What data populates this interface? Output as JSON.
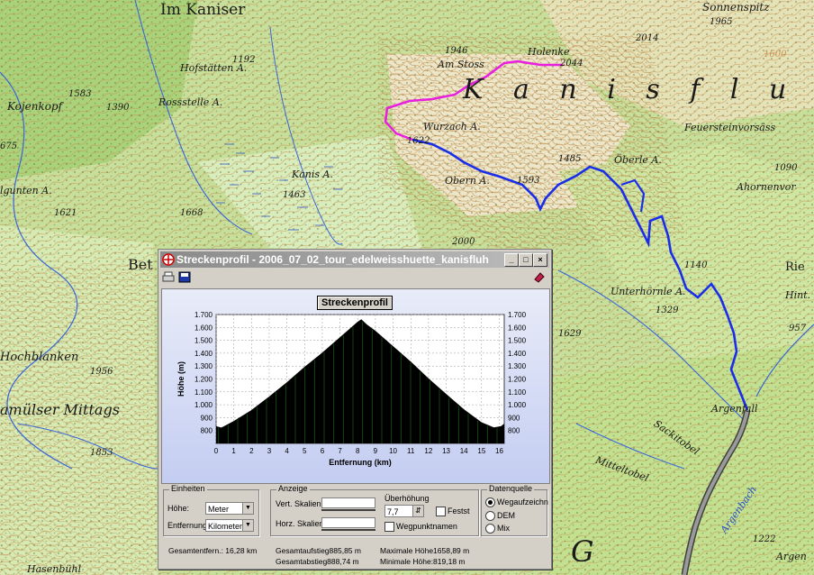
{
  "map": {
    "labels": {
      "im_kaniser": "Im Kaniser",
      "sonnenspitz": "Sonnenspitz",
      "holenke": "Holenke",
      "am_stoss": "Am Stoss",
      "hofstaetten": "Hofstätten A.",
      "rossstelle": "Rossstelle A.",
      "kojenkopf": "Kojenkopf",
      "wurzach": "Wurzach A.",
      "feuersteinvorsass": "Feuersteinvorsäss",
      "oberle": "Öberle A.",
      "obern": "Obern A.",
      "kanis_a": "Kanis A.",
      "ahornenvor": "Ahornenvor",
      "gunten": "lgunten A.",
      "hochblanken": "Hochblanken",
      "mittags": "amülser Mittags",
      "unterhoernle": "Unterhörnle A.",
      "argenfall": "Argenfall",
      "sackitobel": "Sackitobel",
      "mitteltobel": "Mitteltobel",
      "argenbach": "Argenbach",
      "big_kanis": "K a n i s f l u h",
      "hasenbuehl": "Hasenbühl",
      "ried": "Rie",
      "hint": "Hint.",
      "bet": "Bet",
      "big_g": "G",
      "argen": "Argen"
    },
    "spot_heights": [
      "1192",
      "1583",
      "1390",
      "1946",
      "2044",
      "2014",
      "1965",
      "1600",
      "1622",
      "1485",
      "1593",
      "1090",
      "1463",
      "1668",
      "1621",
      "2000",
      "1140",
      "1329",
      "1629",
      "957",
      "1956",
      "1853",
      "1222",
      "1090",
      "675",
      "1222"
    ]
  },
  "window": {
    "title": "Streckenprofil - 2006_07_02_tour_edelweisshuette_kanisfluh",
    "chart_title_button": "Streckenprofil"
  },
  "chart_data": {
    "type": "area",
    "xlabel": "Entfernung (km)",
    "ylabel": "Höhe (m)",
    "xlim": [
      0,
      16.28
    ],
    "ylim": [
      700,
      1700
    ],
    "x_ticks": [
      "0",
      "1",
      "2",
      "3",
      "4",
      "5",
      "6",
      "7",
      "8",
      "9",
      "10",
      "11",
      "12",
      "13",
      "14",
      "15",
      "16"
    ],
    "y_ticks": [
      "800",
      "900",
      "1.000",
      "1.100",
      "1.200",
      "1.300",
      "1.400",
      "1.500",
      "1.600",
      "1.700"
    ],
    "grid": true,
    "series": [
      {
        "x": [
          0,
          0.3,
          1,
          2,
          3,
          4,
          5,
          6,
          7,
          7.5,
          8,
          8.2,
          8.5,
          9,
          10,
          11,
          12,
          13,
          14,
          15,
          15.7,
          16.1,
          16.28
        ],
        "y": [
          830,
          819,
          870,
          955,
          1060,
          1170,
          1290,
          1400,
          1520,
          1580,
          1640,
          1659,
          1620,
          1570,
          1450,
          1330,
          1200,
          1080,
          960,
          860,
          820,
          830,
          850
        ]
      }
    ],
    "colors": {
      "fill": "#000000",
      "accent": "#1a7a1a",
      "bg_top": "#e8ecf8",
      "bg_bottom": "#c4cdf2"
    }
  },
  "settings": {
    "einheiten": {
      "legend": "Einheiten",
      "hoehe_label": "Höhe:",
      "hoehe_value": "Meter",
      "entfernung_label": "Entfernung:",
      "entfernung_value": "Kilometer"
    },
    "anzeige": {
      "legend": "Anzeige",
      "vert_label": "Vert. Skalien.",
      "horz_label": "Horz. Skalien",
      "ueberhoehung_label": "Überhöhung",
      "ueberhoehung_value": "7,7",
      "fest_label": "Festst",
      "wegpunkt_label": "Wegpunktnamen"
    },
    "datenquelle": {
      "legend": "Datenquelle",
      "options": [
        "Wegaufzeichn",
        "DEM",
        "Mix"
      ],
      "selected": "Wegaufzeichn"
    }
  },
  "stats": {
    "gesamtentf": "Gesamtentfern.: 16,28 km",
    "aufstieg": "Gesamtaufstieg885,85 m",
    "abstieg": "Gesamtabstieg888,74 m",
    "max": "Maximale Höhe1658,89 m",
    "min": "Minimale Höhe:819,18 m"
  }
}
